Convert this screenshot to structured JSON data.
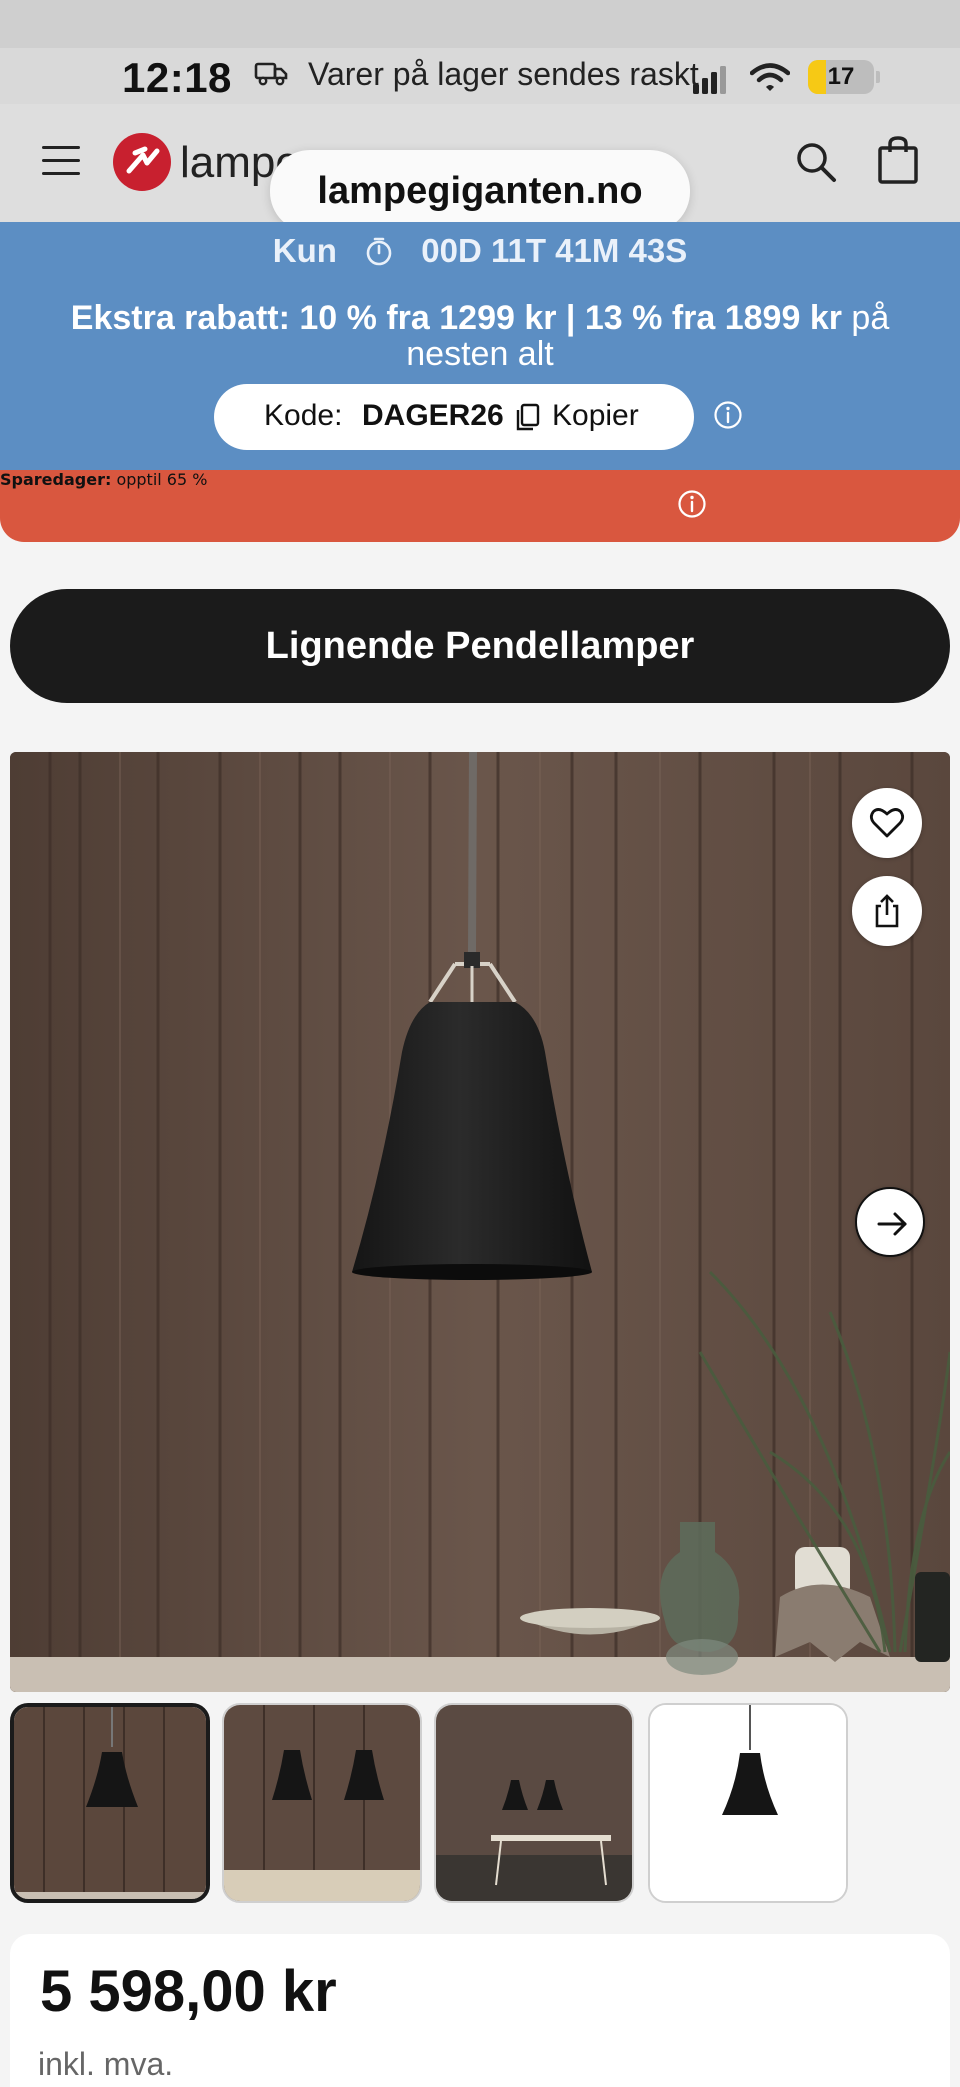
{
  "status_bar": {
    "time": "12:18",
    "banner_text": "Varer på lager sendes raskt",
    "battery": "17",
    "icons": [
      "truck-icon",
      "signal-icon",
      "wifi-icon",
      "battery-icon"
    ]
  },
  "header": {
    "logo_text": "lampe",
    "url": "lampegiganten.no",
    "icons": [
      "hamburger-icon",
      "search-icon",
      "shopping-bag-icon"
    ]
  },
  "promo": {
    "timer_label": "Kun",
    "timer_value": "00D 11T 41M 43S",
    "extra_bold": "Ekstra rabatt: 10 % fra 1299 kr | 13 % fra 1899 kr",
    "extra_rest": " på nesten alt",
    "code_label": "Kode:",
    "code_value": "DAGER26",
    "copy_label": "Kopier",
    "background_color": "#5c8ec3"
  },
  "sale": {
    "bold": "Sparedager:",
    "rest": " opptil 65 %",
    "background_color": "#d9573f"
  },
  "similar_button": "Lignende Pendellamper",
  "gallery": {
    "thumbnails": [
      "thumb-1",
      "thumb-2",
      "thumb-3",
      "thumb-4"
    ],
    "active_index": 0
  },
  "product": {
    "price": "5 598,00 kr",
    "vat_note": "inkl. mva."
  }
}
